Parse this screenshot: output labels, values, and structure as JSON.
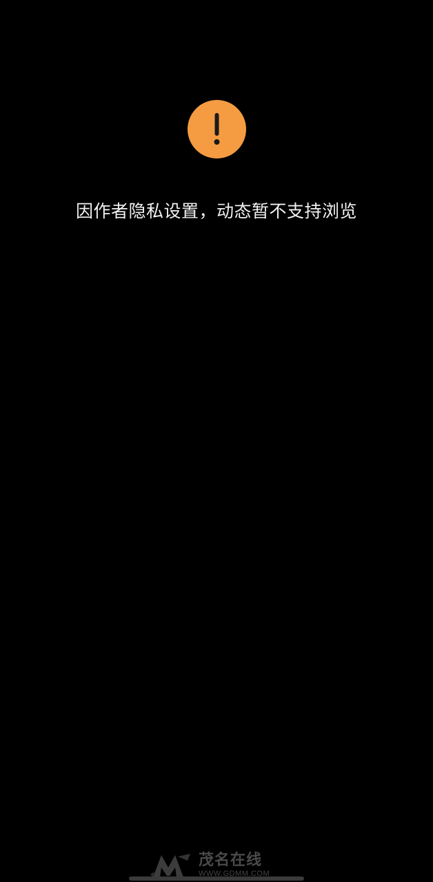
{
  "notice": {
    "icon": "warning-exclamation-icon",
    "icon_color": "#F59B42",
    "message": "因作者隐私设置，动态暂不支持浏览"
  },
  "watermark": {
    "name": "茂名在线",
    "url": "WWW.GDMM.COM"
  }
}
